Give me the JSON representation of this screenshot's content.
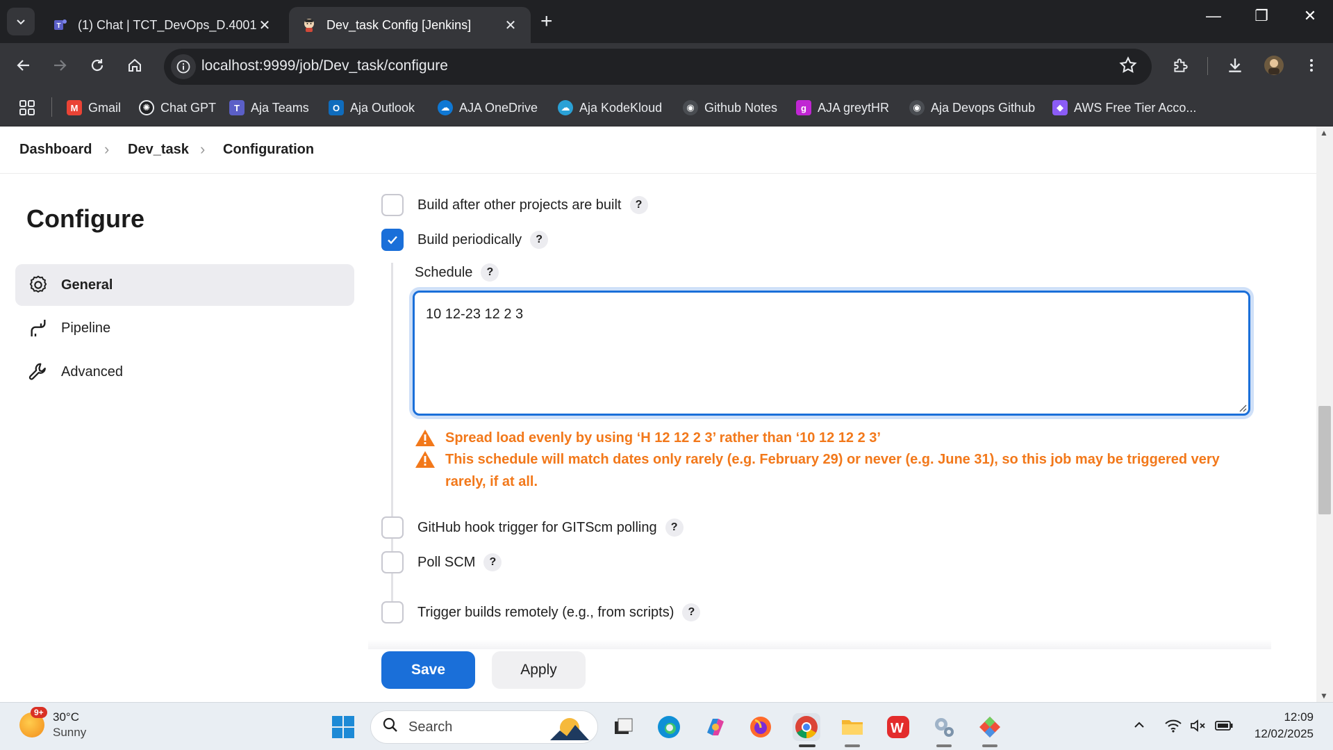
{
  "browser": {
    "tabs": [
      {
        "title": "(1) Chat | TCT_DevOps_D.4001 |",
        "icon": "teams-icon",
        "active": false
      },
      {
        "title": "Dev_task Config [Jenkins]",
        "icon": "jenkins-icon",
        "active": true
      }
    ],
    "url": "localhost:9999/job/Dev_task/configure",
    "bookmarks": [
      {
        "label": "Gmail",
        "icon": "gmail-icon",
        "color": "#ea4335"
      },
      {
        "label": "Chat GPT",
        "icon": "chatgpt-icon",
        "color": "#202124"
      },
      {
        "label": "Aja Teams",
        "icon": "teams-icon",
        "color": "#5b5fc7"
      },
      {
        "label": "Aja Outlook",
        "icon": "outlook-icon",
        "color": "#0f6cbd"
      },
      {
        "label": "AJA OneDrive",
        "icon": "onedrive-icon",
        "color": "#0f78d4"
      },
      {
        "label": "Aja KodeKloud",
        "icon": "kodekloud-icon",
        "color": "#2aa1d6"
      },
      {
        "label": "Github Notes",
        "icon": "github-icon",
        "color": "#6e7681"
      },
      {
        "label": "AJA greytHR",
        "icon": "greythr-icon",
        "color": "#c026d3"
      },
      {
        "label": "Aja Devops Github",
        "icon": "github-icon",
        "color": "#6e7681"
      },
      {
        "label": "AWS Free Tier Acco...",
        "icon": "cube-icon",
        "color": "#8b5cf6"
      }
    ]
  },
  "breadcrumb": {
    "items": [
      "Dashboard",
      "Dev_task",
      "Configuration"
    ]
  },
  "sidebar": {
    "title": "Configure",
    "items": [
      {
        "label": "General",
        "icon": "gear-icon",
        "active": true
      },
      {
        "label": "Pipeline",
        "icon": "pipeline-icon",
        "active": false
      },
      {
        "label": "Advanced",
        "icon": "wrench-icon",
        "active": false
      }
    ]
  },
  "triggers": {
    "help_label": "?",
    "build_after": {
      "label": "Build after other projects are built",
      "checked": false
    },
    "build_periodically": {
      "label": "Build periodically",
      "checked": true
    },
    "schedule": {
      "label": "Schedule",
      "value": "10 12-23 12 2 3",
      "warnings": [
        "Spread load evenly by using ‘H 12 12 2 3’ rather than ‘10 12 12 2 3’",
        "This schedule will match dates only rarely (e.g. February 29) or never (e.g. June 31), so this job may be triggered very rarely, if at all."
      ]
    },
    "github_hook": {
      "label": "GitHub hook trigger for GITScm polling",
      "checked": false
    },
    "poll_scm": {
      "label": "Poll SCM",
      "checked": false
    },
    "trigger_remote": {
      "label": "Trigger builds remotely (e.g., from scripts)",
      "checked": false
    }
  },
  "actions": {
    "save": "Save",
    "apply": "Apply"
  },
  "colors": {
    "primary": "#1a6fd9",
    "warning": "#f2781a"
  },
  "taskbar": {
    "weather": {
      "temp": "30°C",
      "condition": "Sunny",
      "badge": "9+"
    },
    "search_placeholder": "Search",
    "time": "12:09",
    "date": "12/02/2025"
  }
}
